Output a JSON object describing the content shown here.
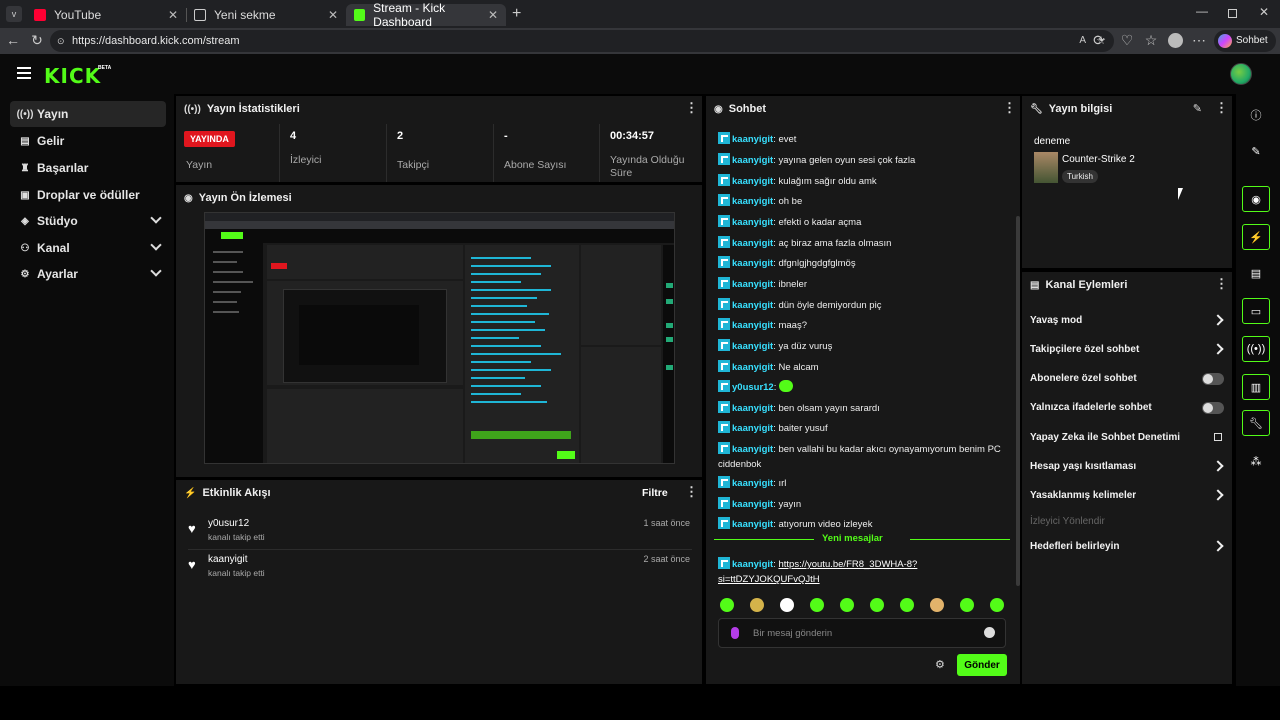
{
  "browser": {
    "tabs": [
      {
        "label": "YouTube",
        "fav_color": "#ff0033"
      },
      {
        "label": "Yeni sekme",
        "fav_color": "#cccccc"
      },
      {
        "label": "Stream - Kick Dashboard",
        "fav_color": "#53fc18"
      }
    ],
    "url": "https://dashboard.kick.com/stream",
    "copilot_label": "Sohbet et"
  },
  "app": {
    "logo": "KICK",
    "logo_badge": "BETA",
    "accent": "#53fc18"
  },
  "sidebar": {
    "items": [
      {
        "label": "Yayın",
        "icon": "broadcast-icon"
      },
      {
        "label": "Gelir",
        "icon": "wallet-icon"
      },
      {
        "label": "Başarılar",
        "icon": "trophy-icon"
      },
      {
        "label": "Droplar ve ödüller",
        "icon": "gift-icon"
      },
      {
        "label": "Stüdyo",
        "icon": "studio-icon"
      },
      {
        "label": "Kanal",
        "icon": "users-icon"
      },
      {
        "label": "Ayarlar",
        "icon": "gear-icon"
      }
    ]
  },
  "stats": {
    "title": "Yayın İstatistikleri",
    "live_badge": "YAYINDA",
    "items": [
      {
        "value": "",
        "label": "Yayın"
      },
      {
        "value": "4",
        "label": "İzleyici"
      },
      {
        "value": "2",
        "label": "Takipçi"
      },
      {
        "value": "-",
        "label": "Abone Sayısı"
      },
      {
        "value": "00:34:57",
        "label": "Yayında Olduğu Süre"
      }
    ]
  },
  "preview": {
    "title": "Yayın Ön İzlemesi"
  },
  "events": {
    "title": "Etkinlik Akışı",
    "filter_label": "Filtre",
    "items": [
      {
        "name": "y0usur12",
        "action": "kanalı takip etti",
        "time": "1 saat önce"
      },
      {
        "name": "kaanyigit",
        "action": "kanalı takip etti",
        "time": "2 saat önce"
      }
    ]
  },
  "chat": {
    "title": "Sohbet",
    "messages": [
      {
        "user": "kaanyigit",
        "text": "evet"
      },
      {
        "user": "kaanyigit",
        "text": "yayına gelen oyun sesi çok fazla"
      },
      {
        "user": "kaanyigit",
        "text": "kulağım sağır oldu amk"
      },
      {
        "user": "kaanyigit",
        "text": "oh be"
      },
      {
        "user": "kaanyigit",
        "text": "efekti o kadar açma"
      },
      {
        "user": "kaanyigit",
        "text": "aç biraz ama fazla olmasın"
      },
      {
        "user": "kaanyigit",
        "text": "dfgnlgjhgdgfglmöş"
      },
      {
        "user": "kaanyigit",
        "text": "ibneler"
      },
      {
        "user": "kaanyigit",
        "text": "dün öyle demiyordun piç"
      },
      {
        "user": "kaanyigit",
        "text": "maaş?"
      },
      {
        "user": "kaanyigit",
        "text": "ya düz vuruş"
      },
      {
        "user": "kaanyigit",
        "text": "Ne alcam"
      },
      {
        "user": "y0usur12",
        "text": ""
      },
      {
        "user": "kaanyigit",
        "text": "ben olsam yayın sarardı"
      },
      {
        "user": "kaanyigit",
        "text": "baiter yusuf"
      },
      {
        "user": "kaanyigit",
        "text": "ben vallahi bu kadar akıcı oynayamıyorum benim PC ciddenbok"
      },
      {
        "user": "kaanyigit",
        "text": "ırl"
      },
      {
        "user": "kaanyigit",
        "text": "yayın"
      },
      {
        "user": "kaanyigit",
        "text": "atıyorum video izleyek"
      }
    ],
    "new_messages_label": "Yeni mesajlar",
    "last_message_user": "kaanyigit",
    "last_message_link": "https://youtu.be/FR8_3DWHA-8?si=ttDZYJOKQUFvQJtH",
    "input_placeholder": "Bir mesaj gönderin",
    "send_label": "Gönder"
  },
  "stream_info": {
    "title_header": "Yayın bilgisi",
    "stream_title": "deneme",
    "game": "Counter-Strike 2",
    "tag": "Turkish"
  },
  "channel_actions": {
    "title": "Kanal Eylemleri",
    "items": [
      {
        "label": "Yavaş mod",
        "control": "chevron"
      },
      {
        "label": "Takipçilere özel sohbet",
        "control": "chevron"
      },
      {
        "label": "Abonelere özel sohbet",
        "control": "toggle"
      },
      {
        "label": "Yalnızca ifadelerle sohbet",
        "control": "toggle"
      },
      {
        "label": "Yapay Zeka ile Sohbet Denetimi",
        "control": "external"
      },
      {
        "label": "Hesap yaşı kısıtlaması",
        "control": "chevron"
      },
      {
        "label": "Yasaklanmış kelimeler",
        "control": "chevron"
      },
      {
        "label": "İzleyici Yönlendir",
        "control": "none"
      },
      {
        "label": "Hedefleri belirleyin",
        "control": "chevron"
      }
    ]
  },
  "rail": {
    "icons": [
      "info-icon",
      "pencil-icon",
      "camera-icon",
      "bolt-icon",
      "document-icon",
      "chat-icon",
      "broadcast-icon",
      "layout-icon",
      "wrench-icon",
      "nodes-icon"
    ]
  }
}
